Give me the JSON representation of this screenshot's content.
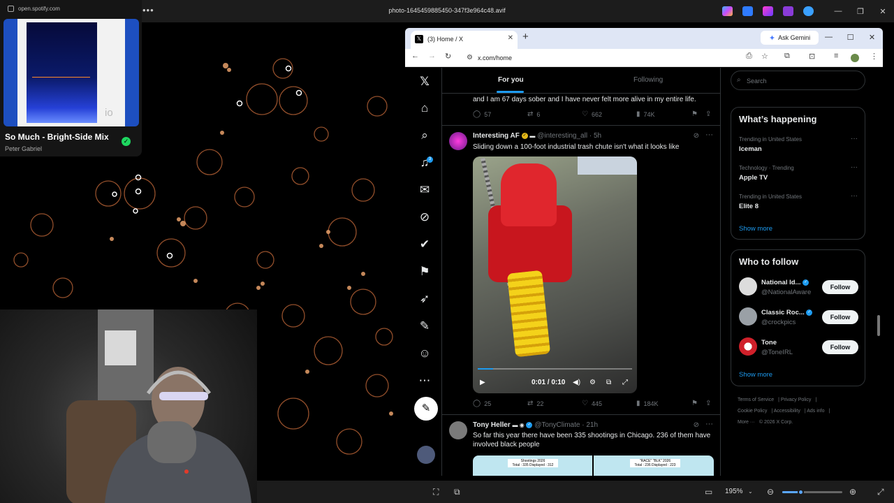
{
  "viewer": {
    "title": "photo-1645459885450-347f3e964c48.avif",
    "zoom": "195%",
    "zoom_fraction": 0.3
  },
  "spotify": {
    "url": "open.spotify.com",
    "song": "So Much - Bright-Side Mix",
    "artist": "Peter Gabriel",
    "album_mark": "io"
  },
  "browser": {
    "tab_title": "(3) Home / X",
    "url": "x.com/home",
    "gemini_label": "Ask Gemini"
  },
  "x": {
    "notif_count": "3",
    "tabs": {
      "for_you": "For you",
      "following": "Following"
    },
    "prev_post": {
      "text": "and I am 67 days sober and I have never felt more alive in my entire life.",
      "replies": "57",
      "reposts": "6",
      "likes": "662",
      "views": "74K"
    },
    "post1": {
      "author": "Interesting AF",
      "handle": "@interesting_all · 5h",
      "text": "Sliding down a 100-foot industrial trash chute isn't what it looks like",
      "video_time": "0:01 / 0:10",
      "video_progress": 0.1,
      "replies": "25",
      "reposts": "22",
      "likes": "445",
      "views": "184K"
    },
    "post2": {
      "author": "Tony Heller",
      "handle": "@TonyClimate · 21h",
      "text": "So far this year there have been 335 shootings in Chicago.  236 of them have involved black people",
      "img1_caption": "Shootings 2026\nTotal : 335 Displayed : 312",
      "img2_caption": "\"RACE\" \"BLK\" 2026\nTotal : 236 Displayed : 223"
    },
    "search_placeholder": "Search",
    "whats_happening": {
      "title": "What’s happening",
      "trends": [
        {
          "meta": "Trending in United States",
          "name": "Iceman"
        },
        {
          "meta": "Technology · Trending",
          "name": "Apple TV"
        },
        {
          "meta": "Trending in United States",
          "name": "Elite 8"
        }
      ],
      "show_more": "Show more"
    },
    "who_to_follow": {
      "title": "Who to follow",
      "accounts": [
        {
          "name": "National Id...",
          "handle": "@NationalAware",
          "button": "Follow"
        },
        {
          "name": "Classic Roc...",
          "handle": "@crockpics",
          "button": "Follow"
        },
        {
          "name": "Tone",
          "handle": "@ToneIRL",
          "button": "Follow"
        }
      ],
      "show_more": "Show more"
    },
    "footer": {
      "terms": "Terms of Service",
      "privacy": "Privacy Policy",
      "cookie": "Cookie Policy",
      "accessibility": "Accessibility",
      "ads": "Ads info",
      "more": "More ···",
      "copyright": "© 2026 X Corp."
    }
  },
  "colors": {
    "accent": "#1d9bf0",
    "spotify_green": "#1ed760",
    "album_blue": "#1d4fc0"
  }
}
